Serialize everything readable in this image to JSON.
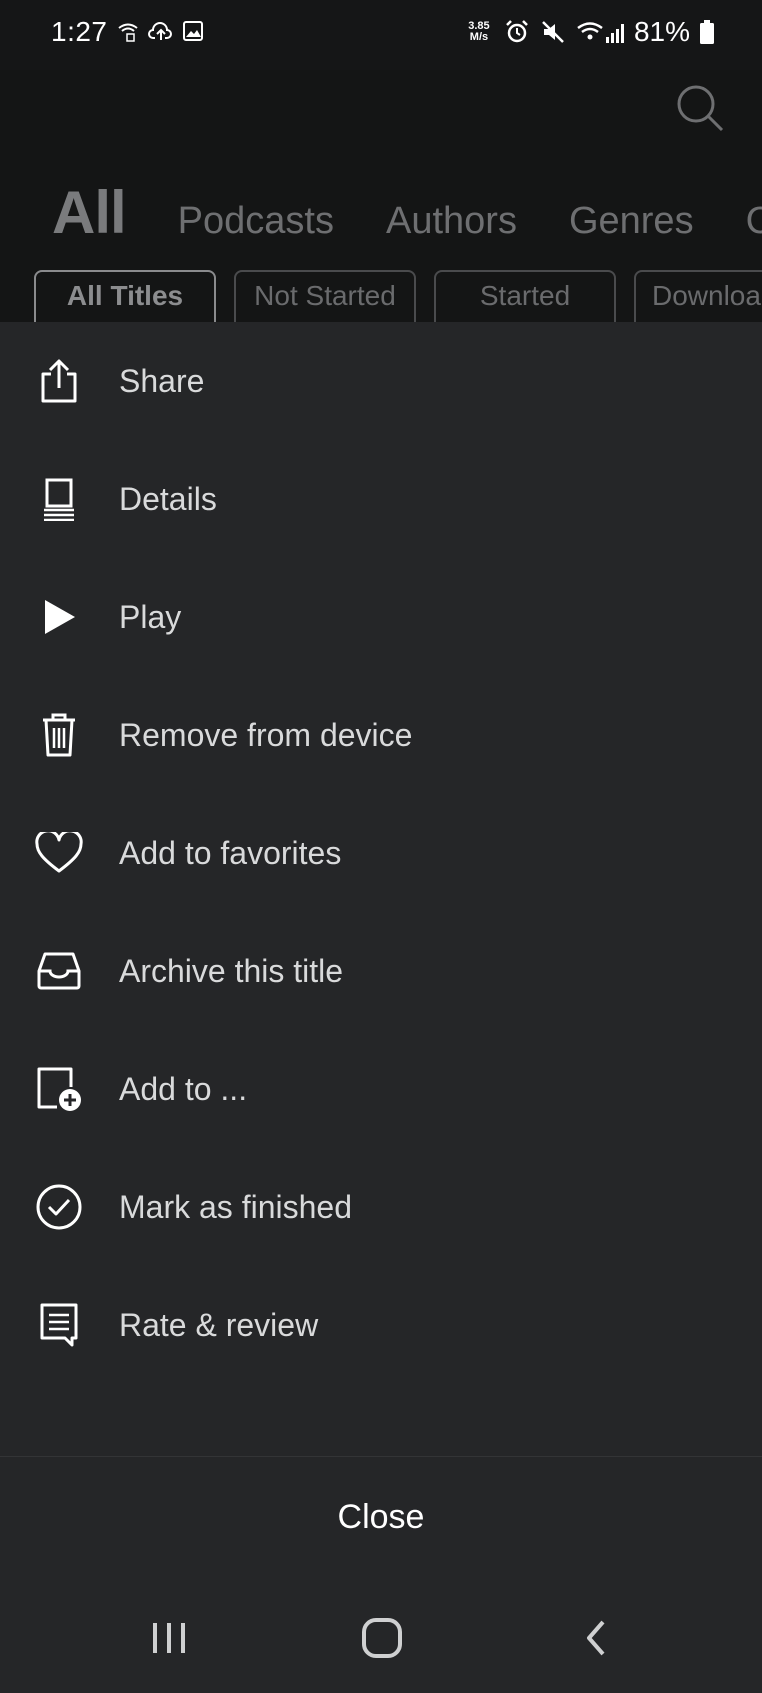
{
  "status_bar": {
    "time": "1:27",
    "speed_value": "3.85",
    "speed_unit": "M/s",
    "battery": "81%"
  },
  "library": {
    "tabs": [
      "All",
      "Podcasts",
      "Authors",
      "Genres",
      "C"
    ],
    "filters": [
      "All Titles",
      "Not Started",
      "Started",
      "Downloa"
    ]
  },
  "menu": {
    "items": [
      {
        "label": "Share",
        "icon": "share-icon"
      },
      {
        "label": "Details",
        "icon": "details-icon"
      },
      {
        "label": "Play",
        "icon": "play-icon"
      },
      {
        "label": "Remove from device",
        "icon": "trash-icon"
      },
      {
        "label": "Add to favorites",
        "icon": "heart-icon"
      },
      {
        "label": "Archive this title",
        "icon": "archive-icon"
      },
      {
        "label": "Add to ...",
        "icon": "add-to-collection-icon"
      },
      {
        "label": "Mark as finished",
        "icon": "check-circle-icon"
      },
      {
        "label": "Rate & review",
        "icon": "review-icon"
      }
    ],
    "close_label": "Close"
  },
  "colors": {
    "sheet_background": "#252628",
    "text_primary": "#d9dadb"
  }
}
